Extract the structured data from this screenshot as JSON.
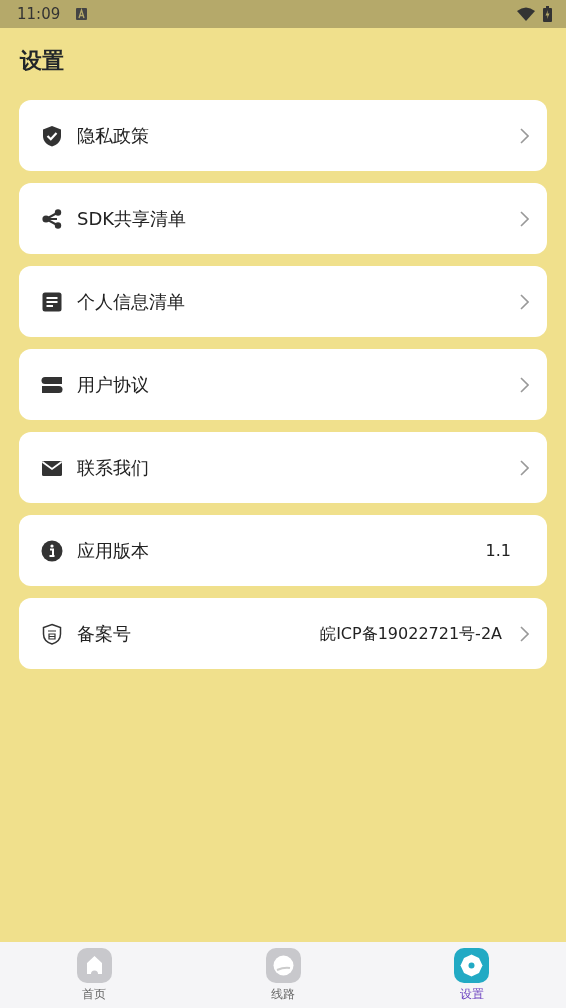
{
  "status_bar": {
    "time": "11:09"
  },
  "title": "设置",
  "items": [
    {
      "label": "隐私政策",
      "chevron": true
    },
    {
      "label": "SDK共享清单",
      "chevron": true
    },
    {
      "label": "个人信息清单",
      "chevron": true
    },
    {
      "label": "用户协议",
      "chevron": true
    },
    {
      "label": "联系我们",
      "chevron": true
    },
    {
      "label": "应用版本",
      "value": "1.1",
      "chevron": false
    },
    {
      "label": "备案号",
      "value": "皖ICP备19022721号-2A",
      "chevron": true
    }
  ],
  "tabs": [
    {
      "label": "首页",
      "selected": false
    },
    {
      "label": "线路",
      "selected": false
    },
    {
      "label": "设置",
      "selected": true
    }
  ]
}
